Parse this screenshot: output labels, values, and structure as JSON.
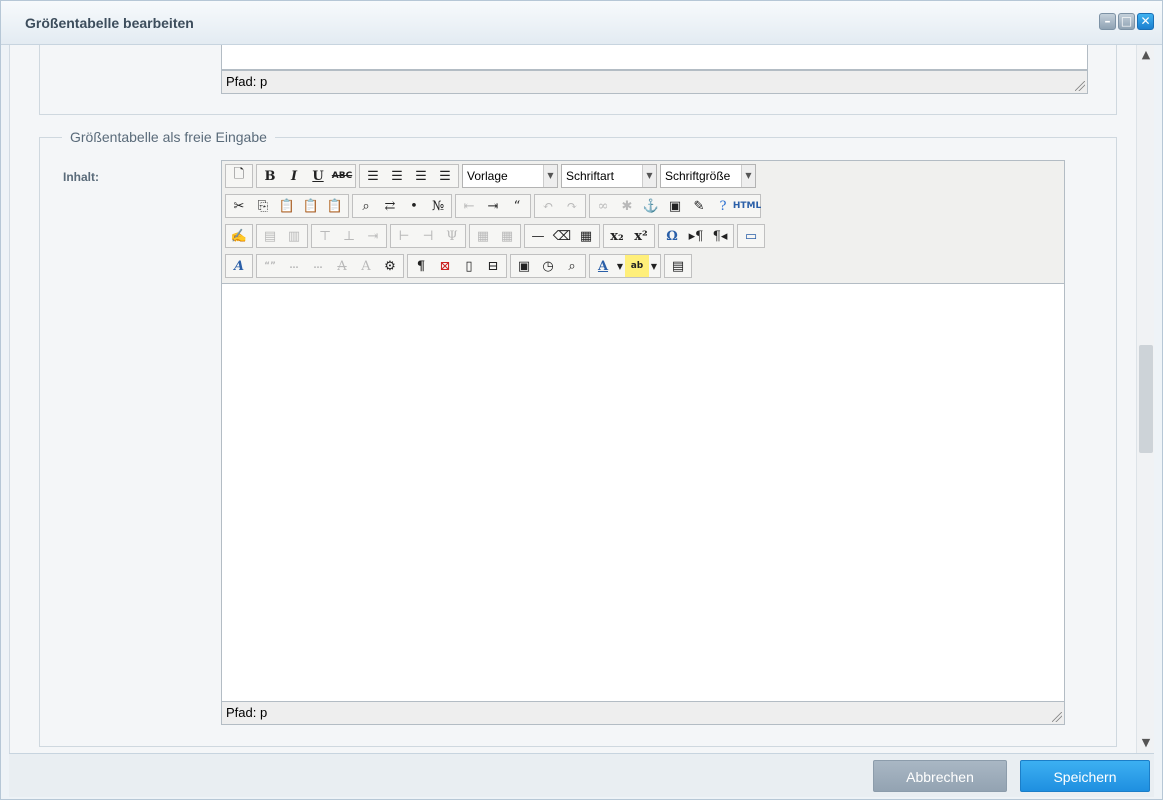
{
  "window": {
    "title": "Größentabelle bearbeiten"
  },
  "top_editor": {
    "path_label": "Pfad: p"
  },
  "section": {
    "legend": "Größentabelle als freie Eingabe",
    "content_label": "Inhalt:"
  },
  "editor": {
    "selects": {
      "format": "Vorlage",
      "font": "Schriftart",
      "size": "Schriftgröße"
    },
    "path_label": "Pfad: p",
    "toolbar_text": {
      "bold": "B",
      "italic": "I",
      "underline": "U",
      "strike": "ABC",
      "html": "HTML",
      "omega": "Ω"
    }
  },
  "footer": {
    "cancel_label": "Abbrechen",
    "save_label": "Speichern"
  },
  "colors": {
    "accent": "#1f8fe0",
    "cancel": "#93a3b2"
  }
}
